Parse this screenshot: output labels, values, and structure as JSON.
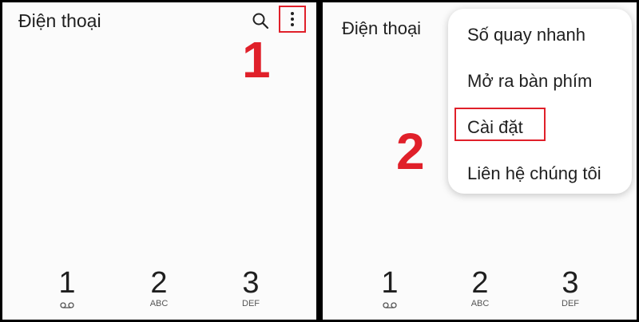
{
  "left_panel": {
    "title": "Điện thoại",
    "step_number": "1",
    "keypad": [
      {
        "digit": "1",
        "sub": "",
        "voicemail": true
      },
      {
        "digit": "2",
        "sub": "ABC"
      },
      {
        "digit": "3",
        "sub": "DEF"
      }
    ]
  },
  "right_panel": {
    "title": "Điện thoại",
    "step_number": "2",
    "menu": {
      "items": [
        "Số quay nhanh",
        "Mở ra bàn phím",
        "Cài đặt",
        "Liên hệ chúng tôi"
      ]
    },
    "keypad": [
      {
        "digit": "1",
        "sub": "",
        "voicemail": true
      },
      {
        "digit": "2",
        "sub": "ABC"
      },
      {
        "digit": "3",
        "sub": "DEF"
      }
    ]
  },
  "colors": {
    "highlight": "#e0202a",
    "background": "#fbfbfb",
    "divider": "#000000"
  },
  "icons": {
    "search": "search-icon",
    "more": "more-vert-icon",
    "voicemail": "voicemail-icon"
  }
}
